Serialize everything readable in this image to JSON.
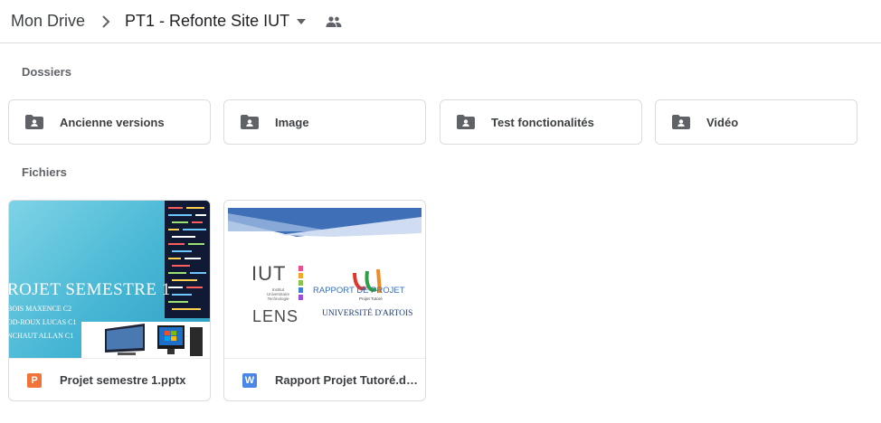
{
  "breadcrumb": {
    "root": "Mon Drive",
    "current": "PT1 - Refonte Site IUT",
    "separator_icon": "chevron-right-icon",
    "dropdown_icon": "caret-down-icon",
    "shared_icon": "people-icon"
  },
  "sections": {
    "folders_label": "Dossiers",
    "files_label": "Fichiers"
  },
  "folders": [
    {
      "name": "Ancienne versions",
      "icon": "shared-folder-icon"
    },
    {
      "name": "Image",
      "icon": "shared-folder-icon"
    },
    {
      "name": "Test fonctionalités",
      "icon": "shared-folder-icon"
    },
    {
      "name": "Vidéo",
      "icon": "shared-folder-icon"
    }
  ],
  "files": [
    {
      "name": "Projet semestre 1.pptx",
      "type_badge": "P",
      "type_color": "#f2733a",
      "thumbnail": {
        "title": "ROJET SEMESTRE 1",
        "names": [
          "BOIS MAXENCE C2",
          "OD-ROUX LUCAS C1",
          "NCHAUT ALLAN C1"
        ]
      }
    },
    {
      "name": "Rapport Projet Tutoré.do...",
      "type_badge": "W",
      "type_color": "#4a86e8",
      "thumbnail": {
        "iut": "IUT",
        "lens": "LENS",
        "iut_sub": [
          "Institut",
          "Universitaire",
          "Technologie"
        ],
        "rapport": "RAPPORT DE PROJET",
        "tutore": "Projet Tutoré",
        "university": "UNIVERSITÉ D'ARTOIS"
      }
    }
  ],
  "colors": {
    "border": "#dadce0",
    "icon": "#5f6368",
    "text": "#3c4043"
  }
}
